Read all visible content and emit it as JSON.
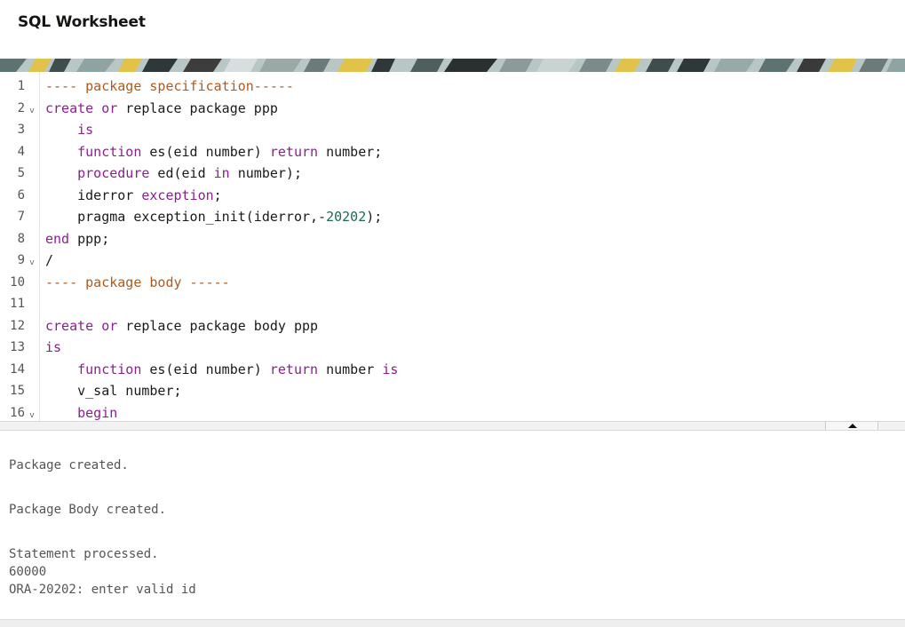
{
  "header": {
    "title": "SQL Worksheet"
  },
  "colors": {
    "comment": "#b05a1d",
    "keyword": "#8a1f8f",
    "number": "#1d6b4e",
    "text": "#1a1a1a",
    "output_text": "#555555"
  },
  "editor": {
    "lines": [
      {
        "num": "1",
        "fold": false,
        "tokens": [
          {
            "t": "---- package specification-----",
            "c": "cm"
          }
        ]
      },
      {
        "num": "2",
        "fold": true,
        "tokens": [
          {
            "t": "create",
            "c": "kw"
          },
          {
            "t": " ",
            "c": "id"
          },
          {
            "t": "or",
            "c": "kw"
          },
          {
            "t": " replace package ppp",
            "c": "id"
          }
        ]
      },
      {
        "num": "3",
        "fold": false,
        "tokens": [
          {
            "t": "    ",
            "c": "id"
          },
          {
            "t": "is",
            "c": "kw"
          }
        ]
      },
      {
        "num": "4",
        "fold": false,
        "tokens": [
          {
            "t": "    ",
            "c": "id"
          },
          {
            "t": "function",
            "c": "kw"
          },
          {
            "t": " es(eid number) ",
            "c": "id"
          },
          {
            "t": "return",
            "c": "kw"
          },
          {
            "t": " number;",
            "c": "id"
          }
        ]
      },
      {
        "num": "5",
        "fold": false,
        "tokens": [
          {
            "t": "    ",
            "c": "id"
          },
          {
            "t": "procedure",
            "c": "kw"
          },
          {
            "t": " ed(eid ",
            "c": "id"
          },
          {
            "t": "in",
            "c": "kw"
          },
          {
            "t": " number);",
            "c": "id"
          }
        ]
      },
      {
        "num": "6",
        "fold": false,
        "tokens": [
          {
            "t": "    iderror ",
            "c": "id"
          },
          {
            "t": "exception",
            "c": "kw"
          },
          {
            "t": ";",
            "c": "id"
          }
        ]
      },
      {
        "num": "7",
        "fold": false,
        "tokens": [
          {
            "t": "    pragma exception_init(iderror,-",
            "c": "id"
          },
          {
            "t": "20202",
            "c": "num"
          },
          {
            "t": ");",
            "c": "id"
          }
        ]
      },
      {
        "num": "8",
        "fold": false,
        "tokens": [
          {
            "t": "end",
            "c": "kw"
          },
          {
            "t": " ppp;",
            "c": "id"
          }
        ]
      },
      {
        "num": "9",
        "fold": true,
        "tokens": [
          {
            "t": "/",
            "c": "id"
          }
        ]
      },
      {
        "num": "10",
        "fold": false,
        "tokens": [
          {
            "t": "---- package body -----",
            "c": "cm"
          }
        ]
      },
      {
        "num": "11",
        "fold": false,
        "tokens": []
      },
      {
        "num": "12",
        "fold": false,
        "tokens": [
          {
            "t": "create",
            "c": "kw"
          },
          {
            "t": " ",
            "c": "id"
          },
          {
            "t": "or",
            "c": "kw"
          },
          {
            "t": " replace package body ppp",
            "c": "id"
          }
        ]
      },
      {
        "num": "13",
        "fold": false,
        "tokens": [
          {
            "t": "is",
            "c": "kw"
          }
        ]
      },
      {
        "num": "14",
        "fold": false,
        "tokens": [
          {
            "t": "    ",
            "c": "id"
          },
          {
            "t": "function",
            "c": "kw"
          },
          {
            "t": " es(eid number) ",
            "c": "id"
          },
          {
            "t": "return",
            "c": "kw"
          },
          {
            "t": " number ",
            "c": "id"
          },
          {
            "t": "is",
            "c": "kw"
          }
        ]
      },
      {
        "num": "15",
        "fold": false,
        "tokens": [
          {
            "t": "    v_sal number;",
            "c": "id"
          }
        ]
      },
      {
        "num": "16",
        "fold": true,
        "tokens": [
          {
            "t": "    ",
            "c": "id"
          },
          {
            "t": "begin",
            "c": "kw"
          }
        ]
      }
    ]
  },
  "output": {
    "lines": [
      "",
      "Package created.",
      "",
      "Package Body created.",
      "",
      "Statement processed.",
      "60000",
      "ORA-20202: enter valid id"
    ]
  }
}
